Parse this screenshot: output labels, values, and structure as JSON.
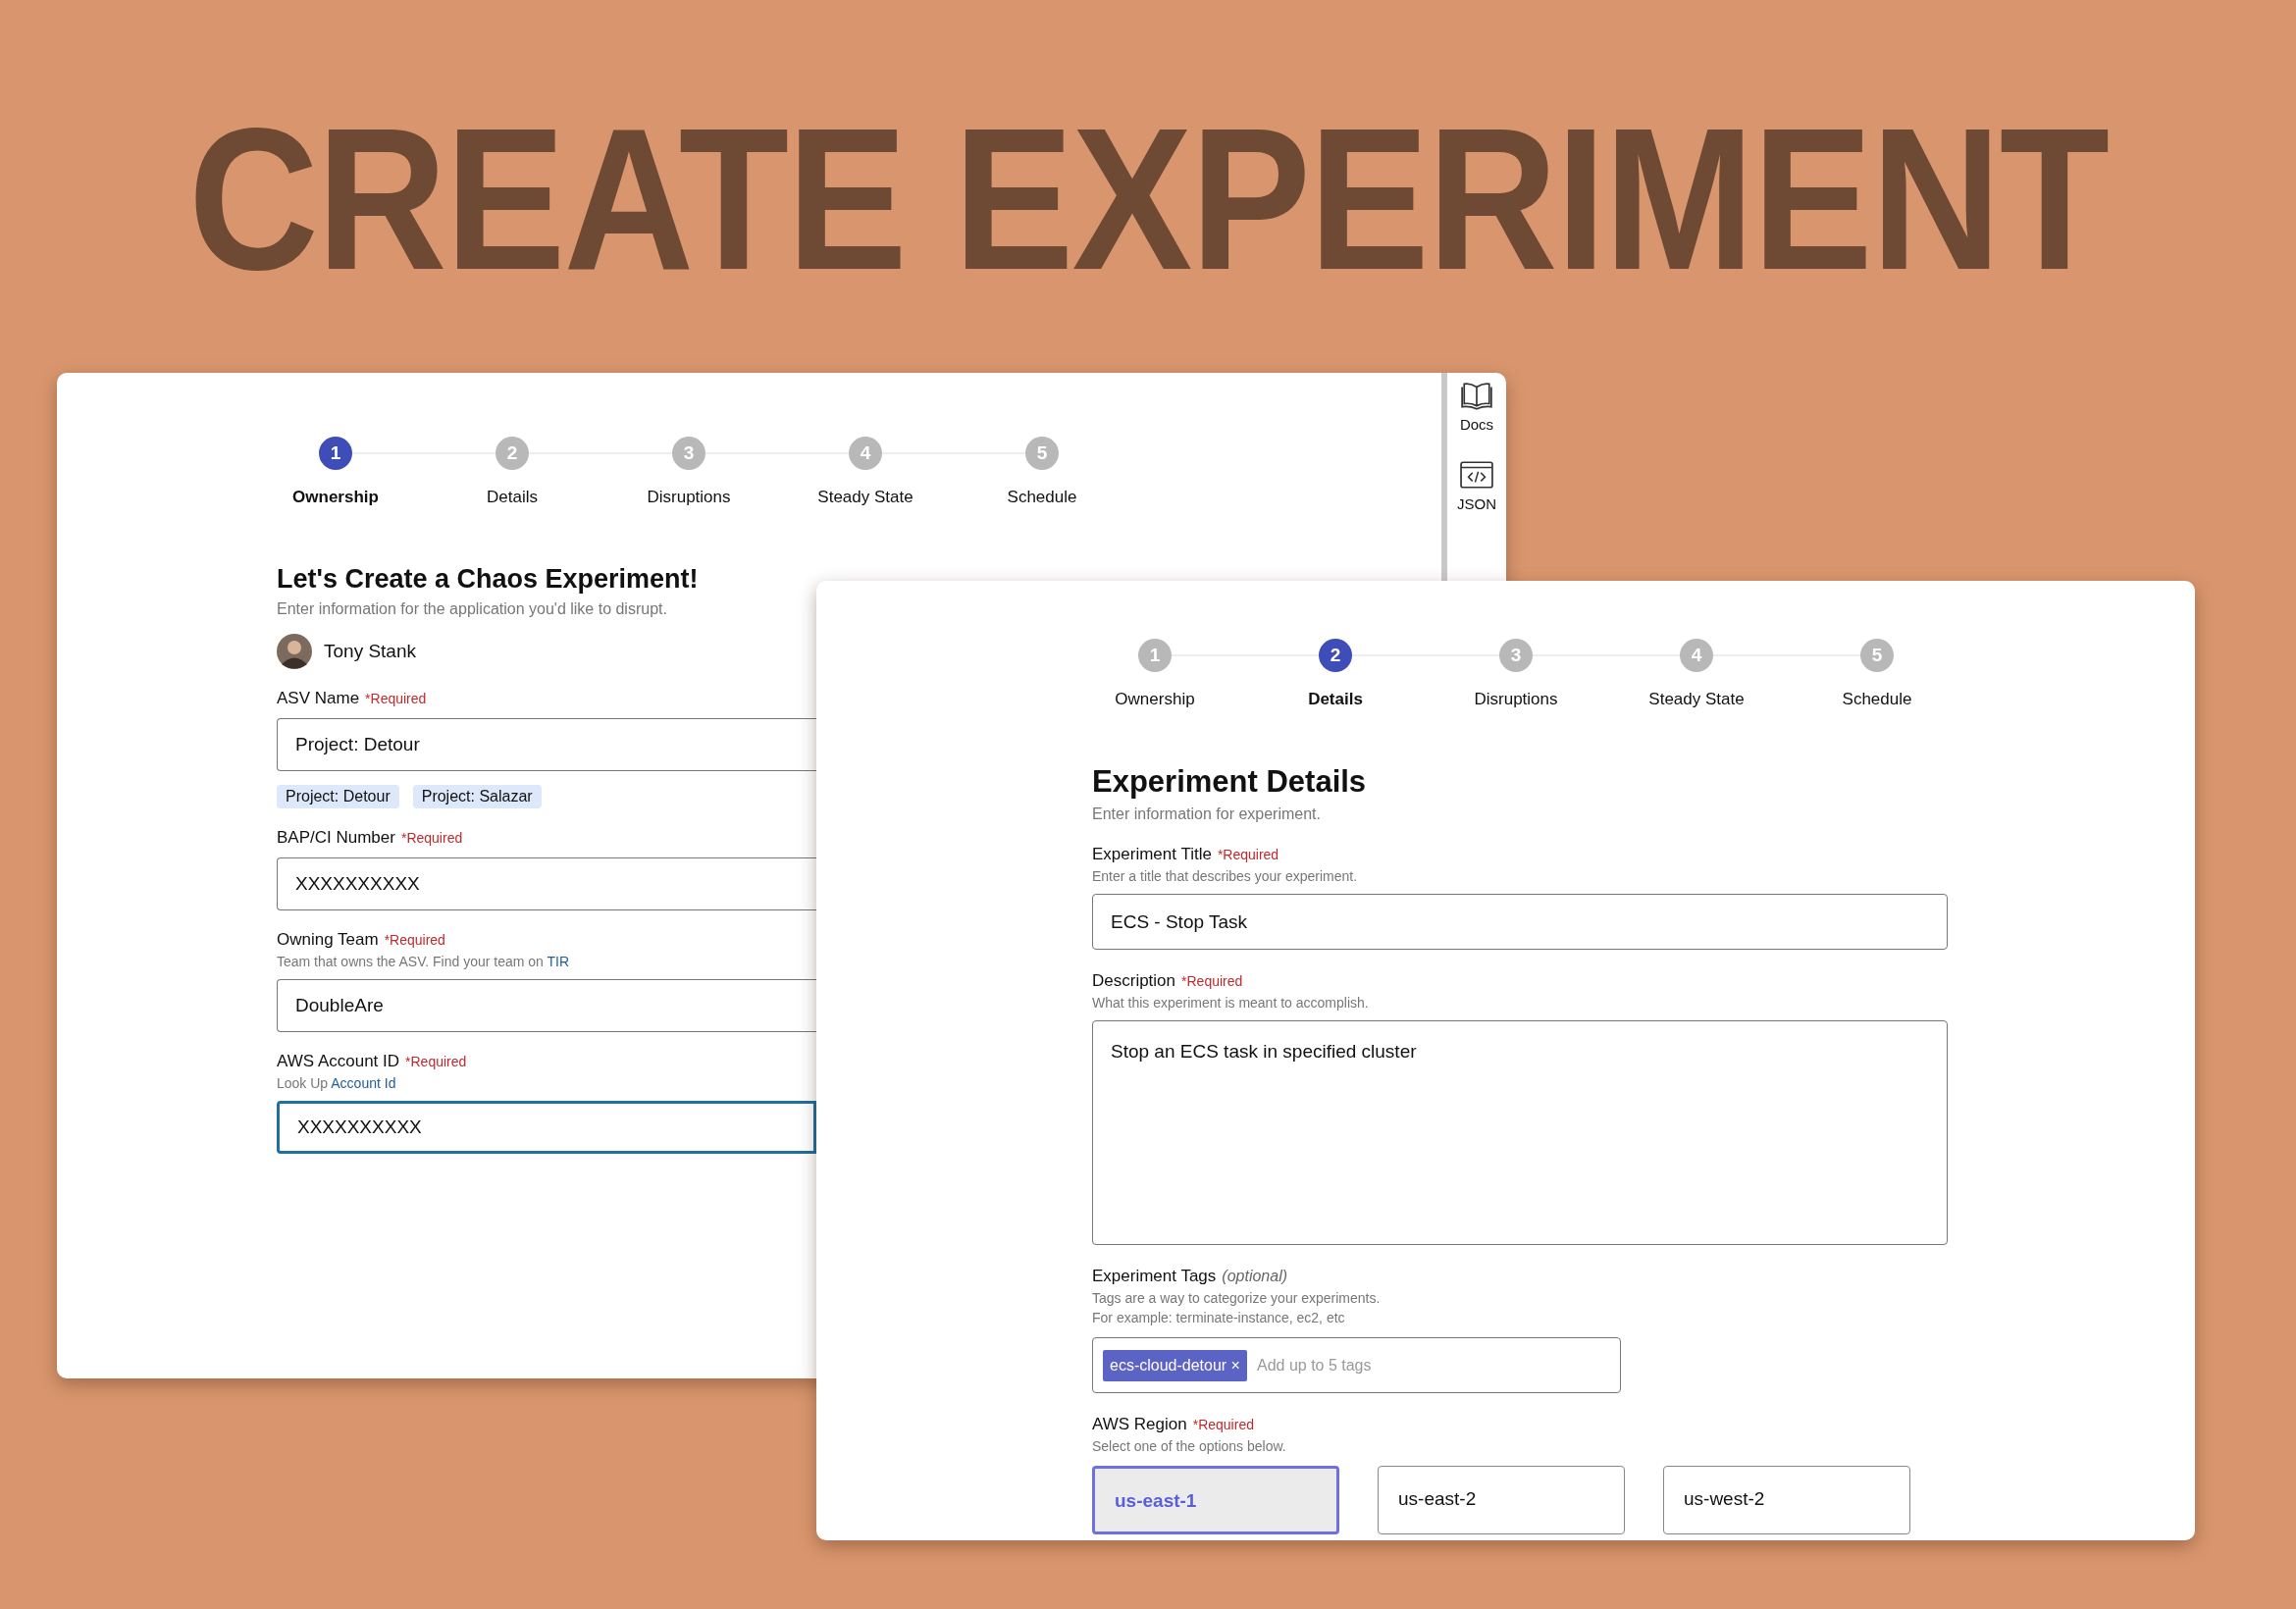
{
  "headline": "CREATE EXPERIMENT",
  "back_window": {
    "steps": [
      {
        "number": "1",
        "label": "Ownership",
        "selected": true
      },
      {
        "number": "2",
        "label": "Details",
        "selected": false
      },
      {
        "number": "3",
        "label": "Disruptions",
        "selected": false
      },
      {
        "number": "4",
        "label": "Steady State",
        "selected": false
      },
      {
        "number": "5",
        "label": "Schedule",
        "selected": false
      }
    ],
    "side_panel": [
      {
        "kind": "docs",
        "label": "Docs"
      },
      {
        "kind": "code",
        "label": "JSON"
      }
    ],
    "heading": "Let's Create a Chaos Experiment!",
    "subheading": "Enter information for the application you'd like to disrupt.",
    "user": {
      "name": "Tony Stank"
    },
    "fields": [
      {
        "label": "ASV Name",
        "required": "*Required",
        "value": "Project: Detour",
        "focused": false,
        "suggestions": [
          "Project: Detour",
          "Project: Salazar"
        ]
      },
      {
        "label": "BAP/CI Number",
        "required": "*Required",
        "value": "XXXXXXXXXX",
        "focused": false
      },
      {
        "label": "Owning Team",
        "required": "*Required",
        "hint": "Team that owns the ASV. Find your team on",
        "hint_link": "TIR",
        "value": "DoubleAre",
        "focused": false
      },
      {
        "label": "AWS Account ID",
        "required": "*Required",
        "hint": "Look Up",
        "hint_link": "Account Id",
        "value": "XXXXXXXXXX",
        "focused": true
      }
    ]
  },
  "front_window": {
    "steps": [
      {
        "number": "1",
        "label": "Ownership",
        "selected": false
      },
      {
        "number": "2",
        "label": "Details",
        "selected": true
      },
      {
        "number": "3",
        "label": "Disruptions",
        "selected": false
      },
      {
        "number": "4",
        "label": "Steady State",
        "selected": false
      },
      {
        "number": "5",
        "label": "Schedule",
        "selected": false
      }
    ],
    "heading": "Experiment Details",
    "subheading": "Enter information for experiment.",
    "fields": [
      {
        "kind": "text",
        "label": "Experiment Title",
        "required": "*Required",
        "hint": "Enter a title that describes your experiment.",
        "value": "ECS - Stop Task"
      },
      {
        "kind": "textarea",
        "label": "Description",
        "required": "*Required",
        "hint": "What this experiment is meant to accomplish.",
        "value": "Stop an ECS task in specified cluster"
      },
      {
        "kind": "tags",
        "label": "Experiment Tags",
        "optional": "(optional)",
        "hint": "Tags are a way to categorize your experiments.",
        "example": "For example: terminate-instance, ec2, etc",
        "tags": [
          {
            "label": "ecs-cloud-detour",
            "remove": "×"
          }
        ],
        "placeholder": "Add up to 5 tags"
      },
      {
        "kind": "options",
        "label": "AWS Region",
        "required": "*Required",
        "hint": "Select one of the options below.",
        "options": [
          {
            "label": "us-east-1",
            "selected": true
          },
          {
            "label": "us-east-2",
            "selected": false
          },
          {
            "label": "us-west-2",
            "selected": false
          }
        ]
      }
    ]
  }
}
